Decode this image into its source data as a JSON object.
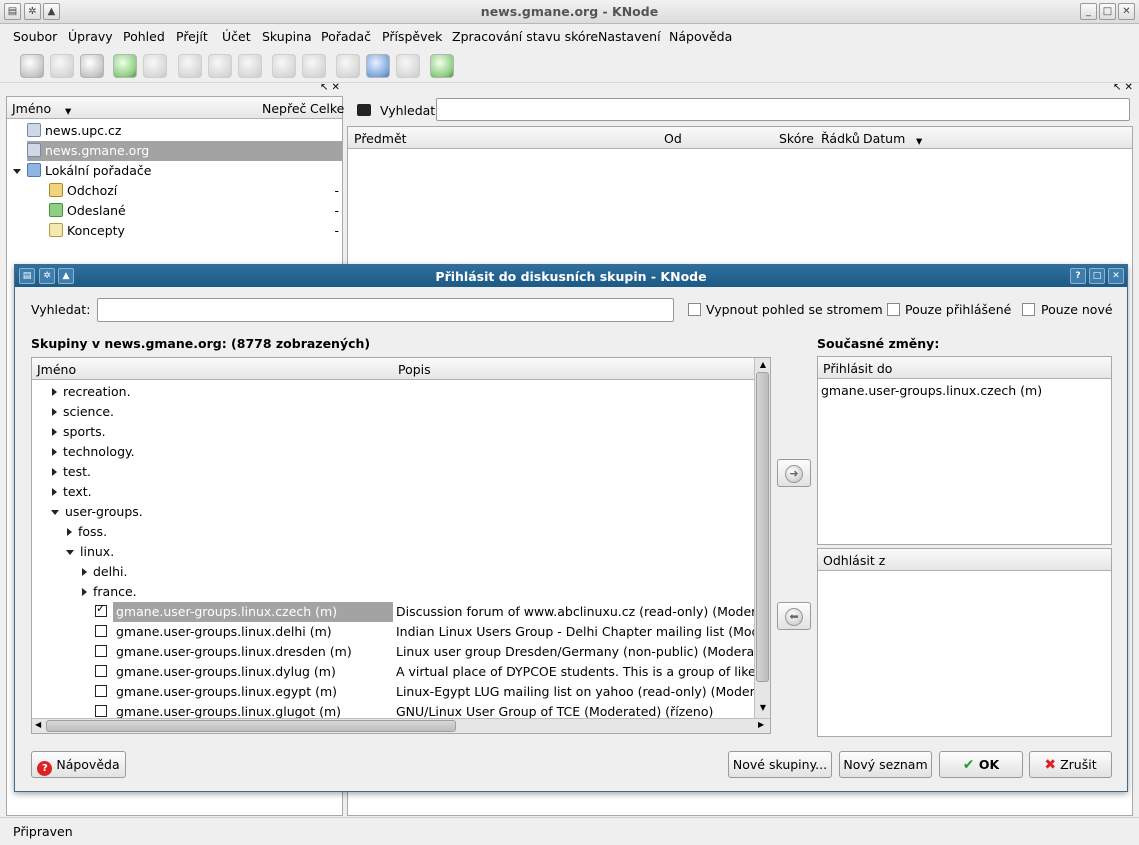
{
  "window": {
    "title": "news.gmane.org - KNode"
  },
  "menu": [
    "Soubor",
    "Úpravy",
    "Pohled",
    "Přejít",
    "Účet",
    "Skupina",
    "Pořadač",
    "Příspěvek",
    "Zpracování stavu skóre",
    "Nastavení",
    "Nápověda"
  ],
  "left": {
    "columns": {
      "name": "Jméno",
      "unread": "Nepřeč",
      "total": "Celke"
    },
    "items": [
      {
        "label": "news.upc.cz",
        "count": ""
      },
      {
        "label": "news.gmane.org",
        "count": ""
      },
      {
        "label": "Lokální pořadače",
        "count": ""
      },
      {
        "label": "Odchozí",
        "count": "-"
      },
      {
        "label": "Odeslané",
        "count": "-"
      },
      {
        "label": "Koncepty",
        "count": "-"
      }
    ]
  },
  "right": {
    "search_label": "Vyhledat:",
    "columns": {
      "subject": "Předmět",
      "from": "Od",
      "score": "Skóre",
      "lines": "Řádků",
      "date": "Datum"
    }
  },
  "dialog": {
    "title": "Přihlásit do diskusních skupin - KNode",
    "search_label": "Vyhledat:",
    "cb_tree": "Vypnout pohled se stromem",
    "cb_subscribed": "Pouze přihlášené",
    "cb_new": "Pouze nové",
    "groups_heading": "Skupiny v news.gmane.org: (8778 zobrazených)",
    "col_name": "Jméno",
    "col_desc": "Popis",
    "tree": [
      {
        "label": "recreation."
      },
      {
        "label": "science."
      },
      {
        "label": "sports."
      },
      {
        "label": "technology."
      },
      {
        "label": "test."
      },
      {
        "label": "text."
      },
      {
        "label": "user-groups."
      },
      {
        "label": "foss."
      },
      {
        "label": "linux."
      },
      {
        "label": "delhi."
      },
      {
        "label": "france."
      }
    ],
    "groups": [
      {
        "name": "gmane.user-groups.linux.czech (m)",
        "desc": "Discussion forum of www.abclinuxu.cz (read-only) (Moderated)",
        "checked": true
      },
      {
        "name": "gmane.user-groups.linux.delhi (m)",
        "desc": "Indian Linux Users Group - Delhi Chapter mailing list (Moderate",
        "checked": false
      },
      {
        "name": "gmane.user-groups.linux.dresden (m)",
        "desc": "Linux user group Dresden/Germany (non-public) (Moderated) (",
        "checked": false
      },
      {
        "name": "gmane.user-groups.linux.dylug (m)",
        "desc": "A virtual place of DYPCOE students. This is a group of like minc",
        "checked": false
      },
      {
        "name": "gmane.user-groups.linux.egypt (m)",
        "desc": "Linux-Egypt LUG mailing list on yahoo (read-only) (Moderated)",
        "checked": false
      },
      {
        "name": "gmane.user-groups.linux.glugot (m)",
        "desc": "GNU/Linux User Group of TCE (Moderated) (řízeno)",
        "checked": false
      }
    ],
    "changes_heading": "Současné změny:",
    "subscribe_header": "Přihlásit do",
    "subscribe_items": [
      "gmane.user-groups.linux.czech (m)"
    ],
    "unsubscribe_header": "Odhlásit z",
    "btn_help": "Nápověda",
    "btn_new_groups": "Nové skupiny...",
    "btn_new_list": "Nový seznam",
    "btn_ok": "OK",
    "btn_cancel": "Zrušit"
  },
  "status": "Připraven"
}
